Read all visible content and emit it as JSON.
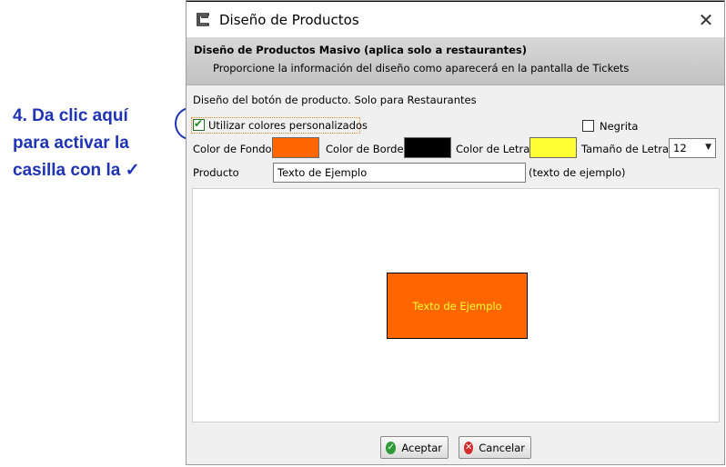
{
  "annotation": {
    "lines": [
      "4. Da clic aquí",
      "para activar la",
      "casilla con la ✓"
    ]
  },
  "window": {
    "title": "Diseño de Productos",
    "close_glyph": "✕"
  },
  "banner": {
    "title": "Diseño de Productos Masivo (aplica solo a restaurantes)",
    "subtitle": "Proporcione la información del diseño como aparecerá en la pantalla de Tickets"
  },
  "form": {
    "section_label": "Diseño del botón de producto. Solo para Restaurantes",
    "custom_colors": {
      "label": "Utilizar colores personalizados",
      "checked": true
    },
    "bold": {
      "label": "Negrita",
      "checked": false
    },
    "background_color": {
      "label": "Color de Fondo",
      "value": "#ff6600"
    },
    "border_color": {
      "label": "Color de Borde",
      "value": "#000000"
    },
    "text_color": {
      "label": "Color de Letra",
      "value": "#ffff33"
    },
    "font_size": {
      "label": "Tamaño de Letra",
      "value": "12"
    },
    "product": {
      "label": "Producto",
      "value": "Texto de Ejemplo",
      "hint": "(texto de ejemplo)"
    }
  },
  "preview": {
    "text": "Texto de Ejemplo"
  },
  "buttons": {
    "accept": "Aceptar",
    "cancel": "Cancelar"
  },
  "colors": {
    "annotation": "#1f33b5",
    "accept_icon": "#2e9a3a",
    "cancel_icon": "#d42a2a"
  }
}
